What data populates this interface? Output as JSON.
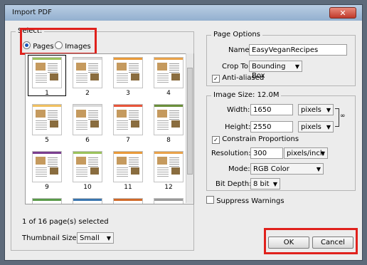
{
  "window": {
    "title": "Import PDF",
    "close_glyph": "✕"
  },
  "select": {
    "legend": "Select:",
    "options": [
      {
        "label": "Pages",
        "checked": true
      },
      {
        "label": "Images",
        "checked": false
      }
    ],
    "thumbnails": [
      {
        "num": "1",
        "band": "#9bc25b"
      },
      {
        "num": "2",
        "band": "#d9d9d9"
      },
      {
        "num": "3",
        "band": "#e89a3a"
      },
      {
        "num": "4",
        "band": "#e8a24a"
      },
      {
        "num": "5",
        "band": "#f0c060"
      },
      {
        "num": "6",
        "band": "#d9d9d9"
      },
      {
        "num": "7",
        "band": "#e7553a"
      },
      {
        "num": "8",
        "band": "#6a8f3a"
      },
      {
        "num": "9",
        "band": "#7a3f8f"
      },
      {
        "num": "10",
        "band": "#9bc25b"
      },
      {
        "num": "11",
        "band": "#e89a3a"
      },
      {
        "num": "12",
        "band": "#e8a24a"
      },
      {
        "num": "",
        "band": "#5a9b4a"
      },
      {
        "num": "",
        "band": "#3a76b0"
      },
      {
        "num": "",
        "band": "#d06a2a"
      },
      {
        "num": "",
        "band": "#9a9a9a"
      }
    ],
    "status": "1 of 16 page(s) selected",
    "thumbnail_size_label": "Thumbnail Size:",
    "thumbnail_size_value": "Small"
  },
  "page_options": {
    "legend": "Page Options",
    "name_label": "Name:",
    "name_value": "EasyVeganRecipes",
    "crop_label": "Crop To:",
    "crop_value": "Bounding Box",
    "anti_aliased_label": "Anti-aliased",
    "anti_aliased": true
  },
  "image_size": {
    "legend": "Image Size: 12.0M",
    "width_label": "Width:",
    "width_value": "1650",
    "width_unit": "pixels",
    "height_label": "Height:",
    "height_value": "2550",
    "height_unit": "pixels",
    "constrain_label": "Constrain Proportions",
    "constrain": true,
    "resolution_label": "Resolution:",
    "resolution_value": "300",
    "resolution_unit": "pixels/inch",
    "mode_label": "Mode:",
    "mode_value": "RGB Color",
    "bitdepth_label": "Bit Depth:",
    "bitdepth_value": "8 bit"
  },
  "suppress_warnings_label": "Suppress Warnings",
  "suppress_warnings": false,
  "buttons": {
    "ok": "OK",
    "cancel": "Cancel"
  },
  "colors": {
    "highlight": "#e0211c",
    "radio_selected": "#1a56b8"
  }
}
